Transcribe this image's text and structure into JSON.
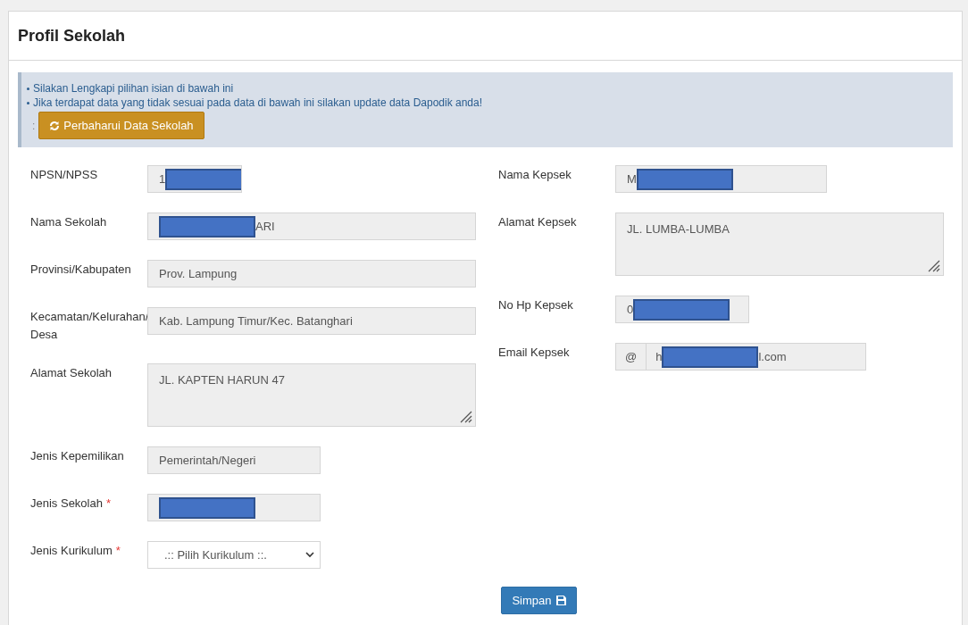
{
  "page": {
    "title": "Profil Sekolah"
  },
  "notice": {
    "lines": [
      "Silakan Lengkapi pilihan isian di bawah ini",
      "Jika terdapat data yang tidak sesuai pada data di bawah ini silakan update data Dapodik anda!"
    ],
    "prefix": ":",
    "button": "Perbaharui Data Sekolah"
  },
  "left_fields": [
    {
      "label": "NPSN/NPSS",
      "kind": "text",
      "prefix": "1",
      "redacted": true
    },
    {
      "label": "Nama Sekolah",
      "kind": "text",
      "redacted": true,
      "suffix": "ARI"
    },
    {
      "label": "Provinsi/Kabupaten",
      "kind": "text",
      "redacted": false,
      "prefix": "Prov. Lampung"
    },
    {
      "label": "Kecamatan/Kelurahan/ Desa",
      "kind": "text",
      "redacted": false,
      "prefix": "Kab. Lampung Timur/Kec. Batanghari"
    },
    {
      "label": "Alamat Sekolah",
      "kind": "textarea",
      "redacted": false,
      "prefix": "JL. KAPTEN HARUN 47"
    },
    {
      "label": "Jenis Kepemilikan",
      "kind": "text",
      "redacted": false,
      "prefix": "Pemerintah/Negeri"
    },
    {
      "label": "Jenis Sekolah",
      "required_mark": "*",
      "kind": "text",
      "redacted": true
    },
    {
      "label": "Jenis Kurikulum",
      "required_mark": "*",
      "kind": "select",
      "redacted": false,
      "prefix": ".:: Pilih Kurikulum ::."
    }
  ],
  "right_fields": [
    {
      "label": "Nama Kepsek",
      "kind": "text",
      "prefix": "M",
      "redacted": true
    },
    {
      "label": "Alamat Kepsek",
      "kind": "textarea",
      "redacted": false,
      "prefix": "JL. LUMBA-LUMBA"
    },
    {
      "label": "No Hp Kepsek",
      "kind": "text",
      "prefix": "0",
      "redacted": true
    },
    {
      "label": "Email Kepsek",
      "kind": "addon",
      "addon": "@",
      "prefix": "h",
      "redacted": true,
      "suffix": "l.com"
    }
  ],
  "save_button": "Simpan"
}
